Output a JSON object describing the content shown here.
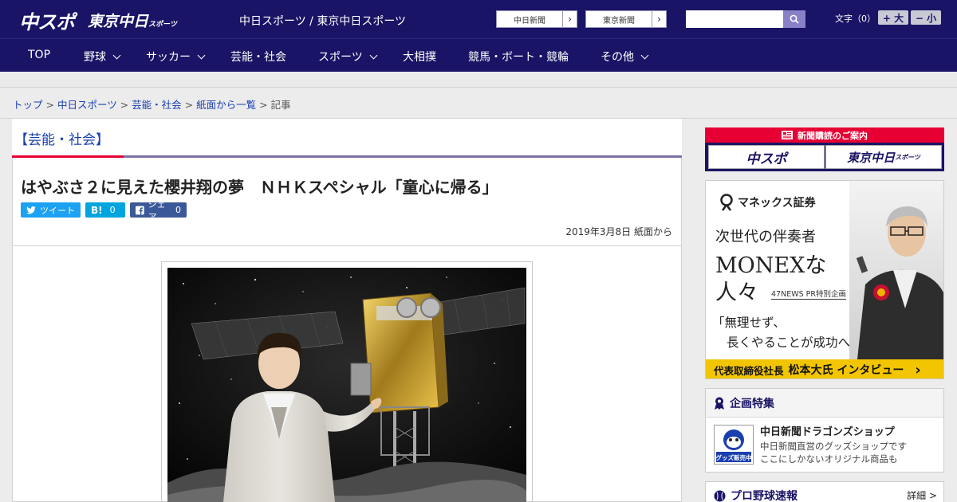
{
  "header": {
    "logo_chuspo": "中スポ",
    "logo_tokyo": "東京中日",
    "logo_tokyo_suffix": "スポーツ",
    "site_names": "中日スポーツ / 東京中日スポーツ",
    "link_chunichi": "中日新聞",
    "link_tokyo": "東京新聞",
    "search_placeholder": "",
    "font_label": "文字（0）",
    "font_bigger": "+ 大",
    "font_smaller": "− 小"
  },
  "nav": {
    "items": [
      {
        "label": "TOP"
      },
      {
        "label": "野球"
      },
      {
        "label": "サッカー"
      },
      {
        "label": "芸能・社会"
      },
      {
        "label": "スポーツ"
      },
      {
        "label": "大相撲"
      },
      {
        "label": "競馬・ボート・競輪"
      },
      {
        "label": "その他"
      }
    ]
  },
  "breadcrumb": {
    "items": [
      "トップ",
      "中日スポーツ",
      "芸能・社会",
      "紙面から一覧"
    ],
    "current": "記事",
    "separator": " > "
  },
  "article": {
    "category": "【芸能・社会】",
    "headline": "はやぶさ２に見えた櫻井翔の夢　ＮＨＫスペシャル「童心に帰る」",
    "share": {
      "tweet_label": "ツイート",
      "hatena_label": "B!",
      "hatena_count": "0",
      "facebook_label": "シェア",
      "facebook_count": "0"
    },
    "date": "2019年3月8日 紙面から"
  },
  "sidebar": {
    "subscribe_heading": "新聞購読のご案内",
    "subscribe_chuspo": "中スポ",
    "subscribe_tokyo": "東京中日",
    "subscribe_tokyo_suffix": "スポーツ",
    "ad": {
      "brand": "マネックス証券",
      "line1": "次世代の伴奏者",
      "line2": "MONEXな",
      "line3": "人々",
      "pr": "47NEWS PR特別企画",
      "quote1": "「無理せず、",
      "quote2": "長くやることが成功への道」",
      "footer_role": "代表取締役社長",
      "footer_name": "松本大氏 インタビュー",
      "footer_arrow": "›"
    },
    "feature": {
      "heading": "企画特集",
      "title": "中日新聞ドラゴンズショップ",
      "desc1": "中日新聞直営のグッズショップです",
      "desc2": "ここにしかないオリジナル商品も",
      "thumb_text": "グッズ販売中"
    },
    "scores": {
      "heading": "プロ野球速報",
      "more": "詳細 >"
    }
  },
  "colors": {
    "brand_navy": "#1a1466",
    "accent_red": "#e60033",
    "link_blue": "#1a3fb0",
    "twitter": "#1da1f2",
    "hatena": "#00a4de",
    "facebook": "#3b5998",
    "ad_yellow": "#f2c500"
  }
}
